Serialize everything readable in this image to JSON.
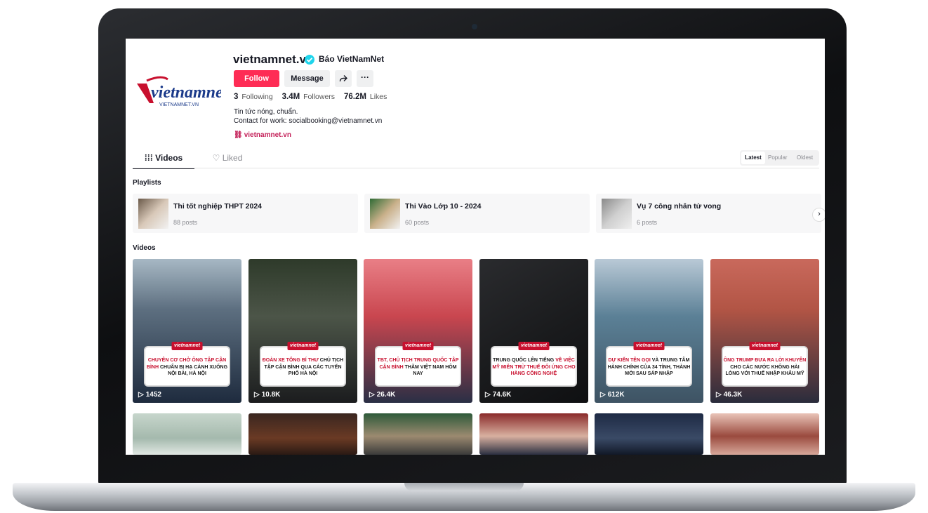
{
  "profile": {
    "username": "vietnamnet.vn",
    "nickname": "Báo VietNamNet",
    "follow_label": "Follow",
    "message_label": "Message",
    "more_label": "···",
    "logo_text": "vietnamnet",
    "logo_sub": "VIETNAMNET.VN",
    "stats": {
      "following_count": "3",
      "following_label": "Following",
      "followers_count": "3.4M",
      "followers_label": "Followers",
      "likes_count": "76.2M",
      "likes_label": "Likes"
    },
    "bio_line1": "Tin tức nóng, chuẩn.",
    "bio_line2": "Contact for work: socialbooking@vietnamnet.vn",
    "link": "vietnamnet.vn"
  },
  "tabs": {
    "videos": "Videos",
    "liked": "Liked"
  },
  "sort": {
    "latest": "Latest",
    "popular": "Popular",
    "oldest": "Oldest"
  },
  "playlists_heading": "Playlists",
  "playlists": [
    {
      "title": "Thi tốt nghiệp THPT 2024",
      "count": "88 posts"
    },
    {
      "title": "Thi Vào Lớp 10 - 2024",
      "count": "60 posts"
    },
    {
      "title": "Vụ 7 công nhân tử vong",
      "count": "6 posts"
    }
  ],
  "videos_heading": "Videos",
  "videos": [
    {
      "views": "1452",
      "cap_red": "CHUYÊN CƠ CHỞ ÔNG TẬP CẬN BÌNH",
      "cap_dark": "CHUẨN BỊ HẠ CÁNH XUỐNG NỘI BÀI, HÀ NỘI"
    },
    {
      "views": "10.8K",
      "cap_red": "ĐOÀN XE TỔNG BÍ THƯ",
      "cap_dark": "CHỦ TỊCH TẬP CẬN BÌNH QUA CÁC TUYẾN PHỐ HÀ NỘI"
    },
    {
      "views": "26.4K",
      "cap_red": "TBT, CHỦ TỊCH TRUNG QUỐC TẬP CẬN BÌNH",
      "cap_dark": "THĂM VIỆT NAM HÔM NAY"
    },
    {
      "views": "74.6K",
      "cap_red": "VỀ VIỆC MỸ MIỄN TRỪ THUẾ ĐỐI ỨNG CHO HÀNG CÔNG NGHỆ",
      "cap_dark": "TRUNG QUỐC LÊN TIẾNG"
    },
    {
      "views": "612K",
      "cap_red": "DỰ KIẾN TÊN GỌI",
      "cap_dark": "VÀ TRUNG TÂM HÀNH CHÍNH CỦA 34 TỈNH, THÀNH MỚI SAU SÁP NHẬP"
    },
    {
      "views": "46.3K",
      "cap_red": "ÔNG TRUMP ĐƯA RA LỜI KHUYÊN",
      "cap_dark": "CHO CÁC NƯỚC KHÔNG HÀI LÒNG VỚI THUẾ NHẬP KHẨU MỸ"
    }
  ],
  "colors": {
    "accent": "#fe2c55",
    "link": "#c4225a",
    "verified": "#20d5ec",
    "caption_red": "#c8102e"
  }
}
